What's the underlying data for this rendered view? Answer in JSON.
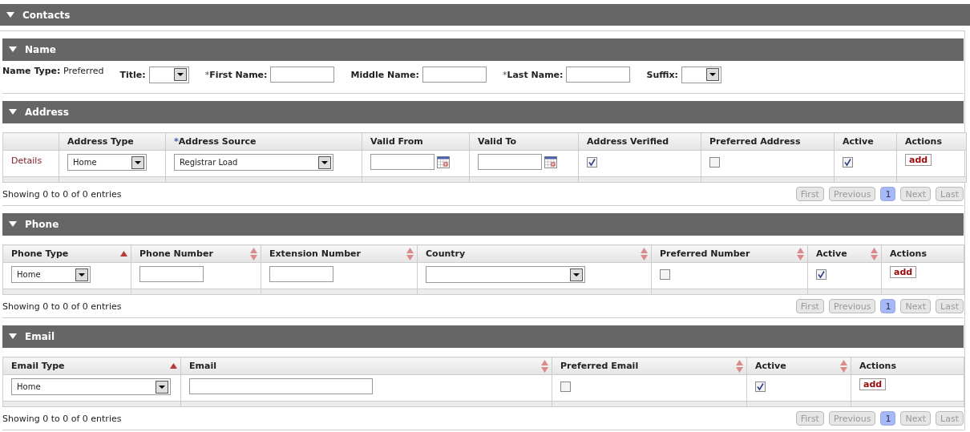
{
  "header": {
    "title": "Contacts",
    "expanded": true
  },
  "name_section": {
    "title": "Name",
    "expanded": true,
    "name_type": {
      "label": "Name Type:",
      "value": "Preferred"
    },
    "fields": [
      {
        "kind": "select",
        "label": "Title:"
      },
      {
        "kind": "text",
        "label": "First Name:",
        "required_mark": "*"
      },
      {
        "kind": "text",
        "label": "Middle Name:"
      },
      {
        "kind": "text",
        "label": "Last Name:",
        "required_mark": "*"
      },
      {
        "kind": "select",
        "label": "Suffix:"
      }
    ]
  },
  "tables": [
    {
      "title": "Address",
      "expanded": true,
      "columns": [
        {},
        {
          "label": "Address Type"
        },
        {
          "label": "Address Source",
          "required_mark": "*"
        },
        {
          "label": "Valid From"
        },
        {
          "label": "Valid To"
        },
        {
          "label": "Address Verified"
        },
        {
          "label": "Preferred Address"
        },
        {
          "label": "Active"
        },
        {
          "label": "Actions"
        }
      ],
      "row": [
        {
          "kind": "link",
          "text": "Details"
        },
        {
          "kind": "select",
          "value": "Home"
        },
        {
          "kind": "select",
          "value": "Registrar Load"
        },
        {
          "kind": "date"
        },
        {
          "kind": "date"
        },
        {
          "kind": "checkbox",
          "checked": true
        },
        {
          "kind": "checkbox",
          "checked": false
        },
        {
          "kind": "checkbox",
          "checked": true
        },
        {
          "kind": "button",
          "text": "add"
        }
      ],
      "info": "Showing 0 to 0 of 0 entries",
      "pager": [
        {
          "label": "First",
          "selected": false
        },
        {
          "label": "Previous",
          "selected": false
        },
        {
          "label": "1",
          "selected": true
        },
        {
          "label": "Next",
          "selected": false
        },
        {
          "label": "Last",
          "selected": false
        }
      ]
    },
    {
      "title": "Phone",
      "expanded": true,
      "columns": [
        {
          "label": "Phone Type",
          "sortable": true,
          "sorted": true
        },
        {
          "label": "Phone Number",
          "sortable": true,
          "sorted": false
        },
        {
          "label": "Extension Number",
          "sortable": true,
          "sorted": false
        },
        {
          "label": "Country",
          "sortable": true,
          "sorted": false
        },
        {
          "label": "Preferred Number",
          "sortable": true,
          "sorted": false
        },
        {
          "label": "Active",
          "sortable": true,
          "sorted": false
        },
        {
          "label": "Actions",
          "sortable": false
        }
      ],
      "row": [
        {
          "kind": "select",
          "value": "Home"
        },
        {
          "kind": "text"
        },
        {
          "kind": "text"
        },
        {
          "kind": "select"
        },
        {
          "kind": "checkbox",
          "checked": false
        },
        {
          "kind": "checkbox",
          "checked": true
        },
        {
          "kind": "button",
          "text": "add"
        }
      ],
      "info": "Showing 0 to 0 of 0 entries",
      "pager": [
        {
          "label": "First",
          "selected": false
        },
        {
          "label": "Previous",
          "selected": false
        },
        {
          "label": "1",
          "selected": true
        },
        {
          "label": "Next",
          "selected": false
        },
        {
          "label": "Last",
          "selected": false
        }
      ]
    },
    {
      "title": "Email",
      "expanded": true,
      "columns": [
        {
          "label": "Email Type",
          "sortable": true,
          "sorted": true
        },
        {
          "label": "Email",
          "sortable": true,
          "sorted": false
        },
        {
          "label": "Preferred Email",
          "sortable": true,
          "sorted": false
        },
        {
          "label": "Active",
          "sortable": true,
          "sorted": false
        },
        {
          "label": "Actions",
          "sortable": false
        }
      ],
      "row": [
        {
          "kind": "select",
          "value": "Home"
        },
        {
          "kind": "text"
        },
        {
          "kind": "checkbox",
          "checked": false
        },
        {
          "kind": "checkbox",
          "checked": true
        },
        {
          "kind": "button",
          "text": "add"
        }
      ],
      "info": "Showing 0 to 0 of 0 entries",
      "pager": [
        {
          "label": "First",
          "selected": false
        },
        {
          "label": "Previous",
          "selected": false
        },
        {
          "label": "1",
          "selected": true
        },
        {
          "label": "Next",
          "selected": false
        },
        {
          "label": "Last",
          "selected": false
        }
      ]
    }
  ]
}
